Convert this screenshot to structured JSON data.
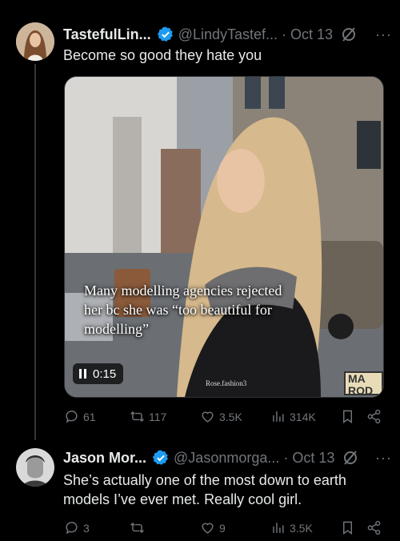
{
  "tweet1": {
    "display_name": "TastefulLin...",
    "handle": "@LindyTastef...",
    "separator": "·",
    "date": "Oct 13",
    "more": "···",
    "text": "Become so good they hate you",
    "media": {
      "caption": "Many modelling agencies rejected her bc she was “too beautiful for modelling”",
      "watermark": "Rose.fashion3",
      "video_time": "0:15",
      "logo_text": "MA\nROD"
    },
    "stats": {
      "replies": "61",
      "reposts": "117",
      "likes": "3.5K",
      "views": "314K"
    }
  },
  "tweet2": {
    "display_name": "Jason Mor...",
    "handle": "@Jasonmorga...",
    "separator": "·",
    "date": "Oct 13",
    "more": "···",
    "text": "She’s actually one of the most down to earth models I’ve ever met. Really cool girl.",
    "stats": {
      "replies": "3",
      "reposts": "",
      "likes": "9",
      "views": "3.5K"
    }
  },
  "colors": {
    "background": "#000000",
    "text": "#e7e9ea",
    "muted": "#71767b",
    "verified": "#1d9bf0"
  }
}
